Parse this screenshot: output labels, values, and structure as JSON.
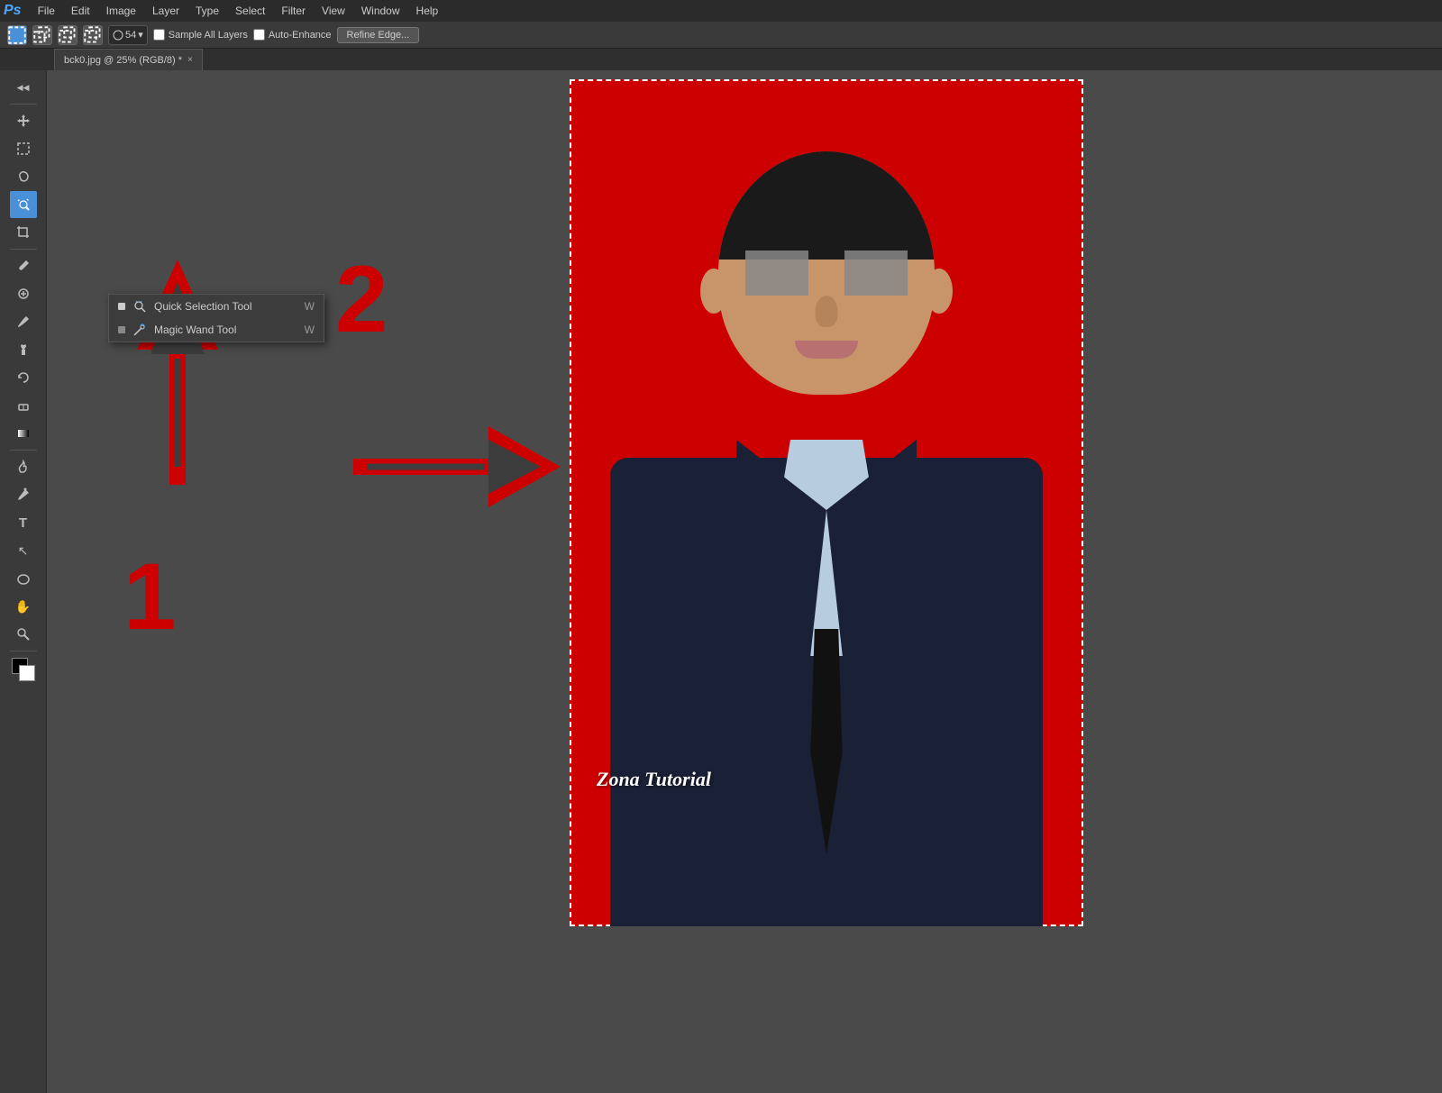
{
  "app": {
    "logo": "Ps",
    "menu_items": [
      "File",
      "Edit",
      "Image",
      "Layer",
      "Type",
      "Select",
      "Filter",
      "View",
      "Window",
      "Help"
    ]
  },
  "options_bar": {
    "brush_size_label": "54",
    "sample_all_layers_label": "Sample All Layers",
    "auto_enhance_label": "Auto-Enhance",
    "refine_edge_label": "Refine Edge..."
  },
  "tab": {
    "filename": "bck0.jpg @ 25% (RGB/8) *",
    "close": "×"
  },
  "context_menu": {
    "items": [
      {
        "id": "quick-selection",
        "label": "Quick Selection Tool",
        "shortcut": "W",
        "has_dot": true,
        "dot_filled": true,
        "icon": "brush-star"
      },
      {
        "id": "magic-wand",
        "label": "Magic Wand Tool",
        "shortcut": "W",
        "has_dot": false,
        "icon": "wand-star"
      }
    ]
  },
  "toolbar": {
    "tools": [
      {
        "id": "move",
        "icon": "✦",
        "label": "Move Tool"
      },
      {
        "id": "rect-select",
        "icon": "⬜",
        "label": "Rectangular Marquee"
      },
      {
        "id": "lasso",
        "icon": "⌇",
        "label": "Lasso"
      },
      {
        "id": "quick-select",
        "icon": "◈",
        "label": "Quick Selection",
        "active": true
      },
      {
        "id": "crop",
        "icon": "⊹",
        "label": "Crop"
      },
      {
        "id": "eyedropper",
        "icon": "⊘",
        "label": "Eyedropper"
      },
      {
        "id": "heal",
        "icon": "⊕",
        "label": "Healing Brush"
      },
      {
        "id": "brush",
        "icon": "✏",
        "label": "Brush"
      },
      {
        "id": "stamp",
        "icon": "⊛",
        "label": "Clone Stamp"
      },
      {
        "id": "history",
        "icon": "↺",
        "label": "History Brush"
      },
      {
        "id": "eraser",
        "icon": "◻",
        "label": "Eraser"
      },
      {
        "id": "gradient",
        "icon": "◼",
        "label": "Gradient"
      },
      {
        "id": "burn",
        "icon": "◑",
        "label": "Dodge/Burn"
      },
      {
        "id": "pen",
        "icon": "✒",
        "label": "Pen"
      },
      {
        "id": "type",
        "icon": "T",
        "label": "Type"
      },
      {
        "id": "path-select",
        "icon": "↖",
        "label": "Path Selection"
      },
      {
        "id": "ellipse",
        "icon": "⬭",
        "label": "Ellipse"
      },
      {
        "id": "hand",
        "icon": "✋",
        "label": "Hand"
      },
      {
        "id": "zoom",
        "icon": "🔍",
        "label": "Zoom"
      }
    ]
  },
  "annotations": {
    "number1": "1",
    "number2": "2",
    "arrow1_direction": "up",
    "arrow2_direction": "right"
  },
  "watermark": {
    "text": "Zona Tutorial"
  },
  "photo": {
    "background_color": "#cc0000",
    "selection_active": true
  }
}
